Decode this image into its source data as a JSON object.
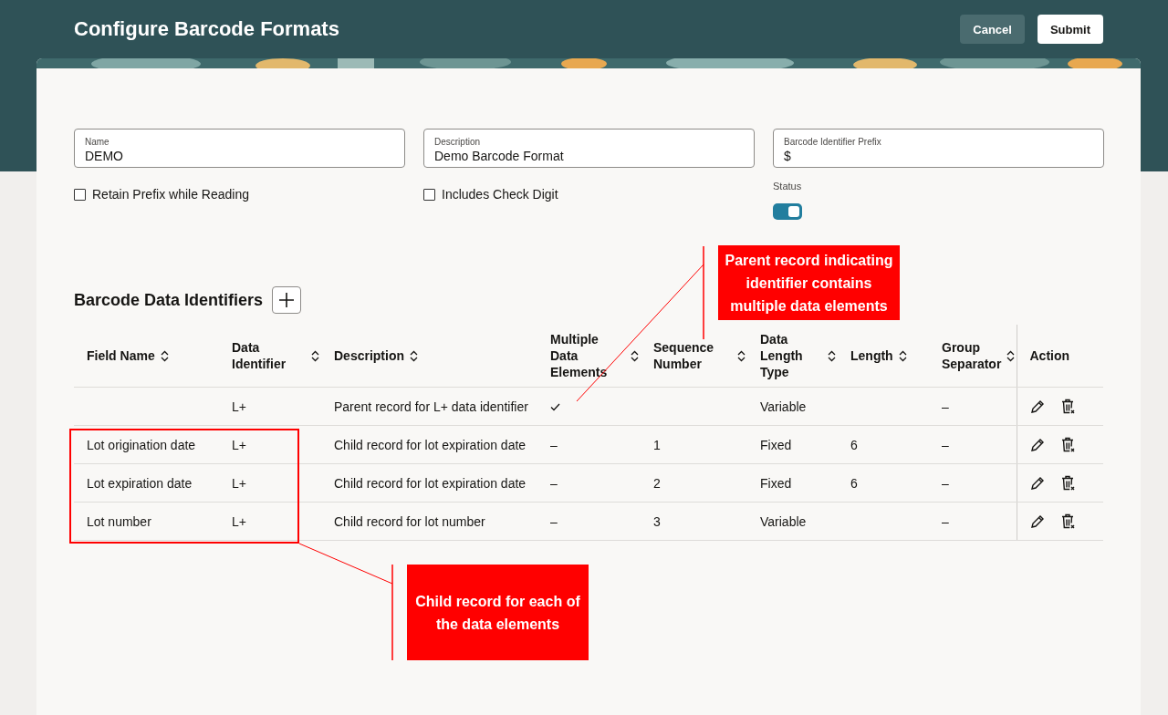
{
  "header": {
    "title": "Configure Barcode Formats",
    "buttons": [
      {
        "label": "Cancel",
        "kind": "secondary"
      },
      {
        "label": "Submit",
        "kind": "primary"
      }
    ]
  },
  "form": {
    "fields": [
      {
        "label": "Name",
        "value": "DEMO"
      },
      {
        "label": "Description",
        "value": "Demo Barcode Format"
      },
      {
        "label": "Barcode Identifier Prefix",
        "value": "$"
      }
    ],
    "checkboxes": [
      {
        "label": "Retain Prefix while Reading",
        "checked": false
      },
      {
        "label": "Includes Check Digit",
        "checked": false
      }
    ],
    "status": {
      "label": "Status",
      "on": true
    }
  },
  "section": {
    "title": "Barcode Data Identifiers"
  },
  "table": {
    "columns": [
      {
        "label": "Field Name",
        "sortable": true
      },
      {
        "label": "Data Identifier",
        "sortable": true
      },
      {
        "label": "Description",
        "sortable": true
      },
      {
        "label": "Multiple Data Elements",
        "sortable": true
      },
      {
        "label": "Sequence Number",
        "sortable": true
      },
      {
        "label": "Data Length Type",
        "sortable": true
      },
      {
        "label": "Length",
        "sortable": true
      },
      {
        "label": "Group Separator",
        "sortable": true
      },
      {
        "label": "Action",
        "sortable": false
      }
    ],
    "rows": [
      {
        "field_name": "",
        "data_identifier": "L+",
        "description": "Parent record for L+ data identifier",
        "multiple": {
          "checked": true
        },
        "sequence": "",
        "length_type": "Variable",
        "length": "",
        "group_separator": "–"
      },
      {
        "field_name": "Lot origination date",
        "data_identifier": "L+",
        "description": "Child record for lot expiration date",
        "multiple": {
          "checked": false,
          "text": "–"
        },
        "sequence": "1",
        "length_type": "Fixed",
        "length": "6",
        "group_separator": "–"
      },
      {
        "field_name": "Lot expiration date",
        "data_identifier": "L+",
        "description": "Child record for lot expiration date",
        "multiple": {
          "checked": false,
          "text": "–"
        },
        "sequence": "2",
        "length_type": "Fixed",
        "length": "6",
        "group_separator": "–"
      },
      {
        "field_name": "Lot number",
        "data_identifier": "L+",
        "description": "Child record for lot number",
        "multiple": {
          "checked": false,
          "text": "–"
        },
        "sequence": "3",
        "length_type": "Variable",
        "length": "",
        "group_separator": "–"
      }
    ]
  },
  "annotations": [
    {
      "text": "Parent record indicating identifier contains multiple data elements"
    },
    {
      "text": "Child record for each of the data elements"
    }
  ]
}
